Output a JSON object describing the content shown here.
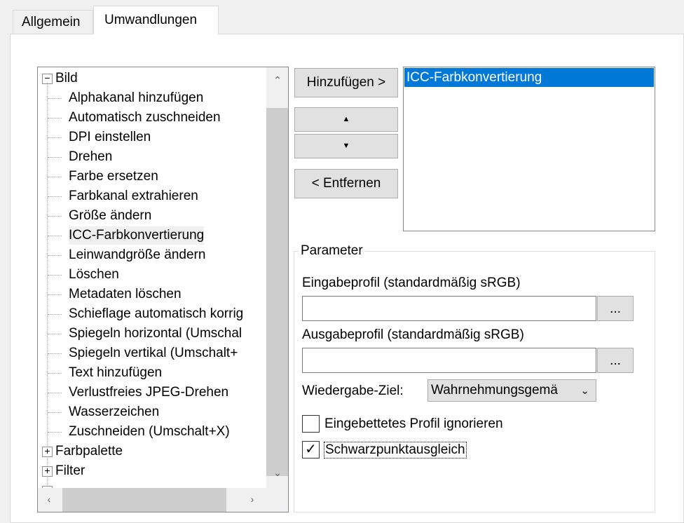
{
  "tabs": [
    {
      "label": "Allgemein",
      "active": false
    },
    {
      "label": "Umwandlungen",
      "active": true
    }
  ],
  "tree": {
    "root": {
      "label": "Bild",
      "expander": "−"
    },
    "children": [
      "Alphakanal hinzufügen",
      "Automatisch zuschneiden",
      "DPI einstellen",
      "Drehen",
      "Farbe ersetzen",
      "Farbkanal extrahieren",
      "Größe ändern",
      "ICC-Farbkonvertierung",
      "Leinwandgröße ändern",
      "Löschen",
      "Metadaten löschen",
      "Schieflage automatisch korrig",
      "Spiegeln horizontal  (Umschal",
      "Spiegeln vertikal  (Umschalt+",
      "Text hinzufügen",
      "Verlustfreies JPEG-Drehen",
      "Wasserzeichen",
      "Zuschneiden  (Umschalt+X)"
    ],
    "selected_child": "ICC-Farbkonvertierung",
    "siblings": [
      {
        "label": "Farbpalette",
        "expander": "+"
      },
      {
        "label": "Filter",
        "expander": "+"
      }
    ]
  },
  "buttons": {
    "add": "Hinzufügen >",
    "up": "▲",
    "down": "▼",
    "remove": "< Entfernen",
    "browse_input": "...",
    "browse_output": "..."
  },
  "applied_list": [
    "ICC-Farbkonvertierung"
  ],
  "params": {
    "legend": "Parameter",
    "input_label": "Eingabeprofil (standardmäßig sRGB)",
    "input_value": "",
    "output_label": "Ausgabeprofil (standardmäßig sRGB)",
    "output_value": "",
    "intent_label": "Wiedergabe-Ziel:",
    "intent_value": "Wahrnehmungsgemä",
    "ignore_label": "Eingebettetes Profil ignorieren",
    "ignore_checked": false,
    "blackpoint_label": "Schwarzpunktausgleich",
    "blackpoint_checked": true
  },
  "colors": {
    "selection": "#0078d7",
    "button": "#e1e1e1",
    "border": "#adadad"
  }
}
